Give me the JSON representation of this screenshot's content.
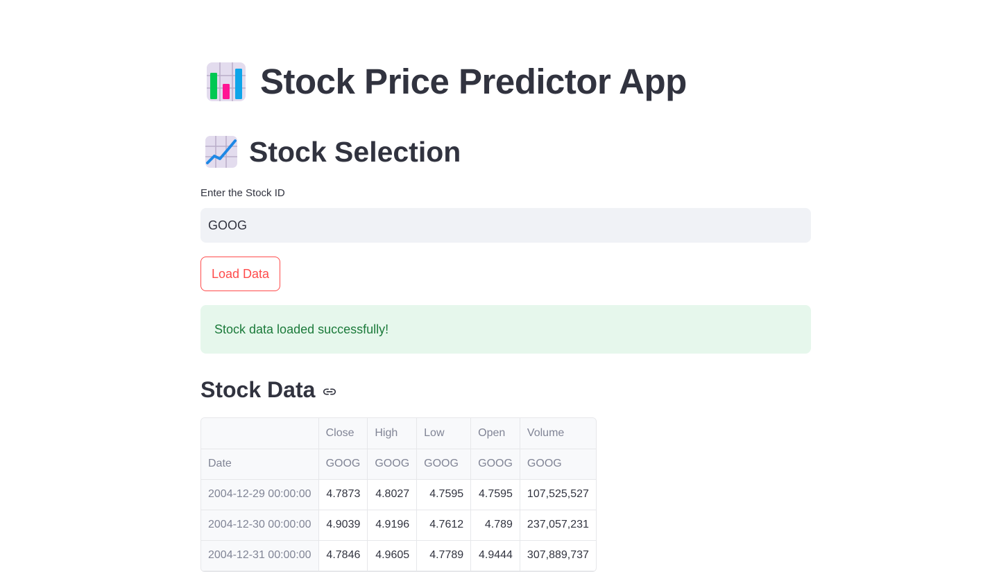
{
  "app": {
    "title": "Stock Price Predictor App",
    "title_icon": "bar-chart-icon"
  },
  "section": {
    "title": "Stock Selection",
    "icon": "chart-increasing-icon"
  },
  "stock_input": {
    "label": "Enter the Stock ID",
    "value": "GOOG"
  },
  "load_button": {
    "label": "Load Data"
  },
  "alert": {
    "message": "Stock data loaded successfully!",
    "type": "success"
  },
  "data_section": {
    "title": "Stock Data",
    "anchor_icon": "link-icon"
  },
  "table": {
    "columns": [
      {
        "field": "Close",
        "ticker": "GOOG"
      },
      {
        "field": "High",
        "ticker": "GOOG"
      },
      {
        "field": "Low",
        "ticker": "GOOG"
      },
      {
        "field": "Open",
        "ticker": "GOOG"
      },
      {
        "field": "Volume",
        "ticker": "GOOG"
      }
    ],
    "index_label": "Date",
    "rows": [
      {
        "date": "2004-12-29 00:00:00",
        "close": "4.7873",
        "high": "4.8027",
        "low": "4.7595",
        "open": "4.7595",
        "volume": "107,525,527"
      },
      {
        "date": "2004-12-30 00:00:00",
        "close": "4.9039",
        "high": "4.9196",
        "low": "4.7612",
        "open": "4.789",
        "volume": "237,057,231"
      },
      {
        "date": "2004-12-31 00:00:00",
        "close": "4.7846",
        "high": "4.9605",
        "low": "4.7789",
        "open": "4.9444",
        "volume": "307,889,737"
      }
    ]
  },
  "colors": {
    "accent": "#ff4b4b",
    "text": "#31333f",
    "success_bg": "#e6f7ec",
    "success_text": "#1b7a3a",
    "input_bg": "#f0f2f6"
  }
}
